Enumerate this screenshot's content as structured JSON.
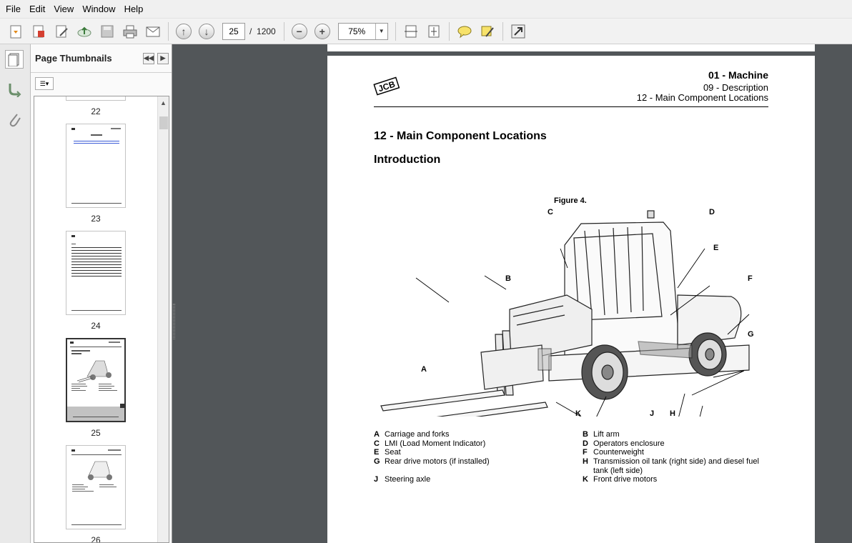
{
  "menu": [
    "File",
    "Edit",
    "View",
    "Window",
    "Help"
  ],
  "toolbar": {
    "page_current": "25",
    "page_sep": "/",
    "page_total": "1200",
    "zoom": "75%"
  },
  "panel": {
    "title": "Page Thumbnails"
  },
  "thumbnails": [
    {
      "label": "22"
    },
    {
      "label": "23"
    },
    {
      "label": "24"
    },
    {
      "label": "25"
    },
    {
      "label": "26"
    }
  ],
  "document": {
    "header_title": "01 - Machine",
    "header_sub1": "09 - Description",
    "header_sub2": "12 - Main Component Locations",
    "logo": "JCB",
    "heading": "12 - Main Component Locations",
    "subheading": "Introduction",
    "figure_caption": "Figure 4.",
    "callouts": {
      "A": "A",
      "B": "B",
      "C": "C",
      "D": "D",
      "E": "E",
      "F": "F",
      "G": "G",
      "H": "H",
      "J": "J",
      "K": "K"
    },
    "legend": [
      {
        "key": "A",
        "text": "Carriage and forks"
      },
      {
        "key": "B",
        "text": "Lift arm"
      },
      {
        "key": "C",
        "text": "LMI (Load Moment Indicator)"
      },
      {
        "key": "D",
        "text": "Operators enclosure"
      },
      {
        "key": "E",
        "text": "Seat"
      },
      {
        "key": "F",
        "text": "Counterweight"
      },
      {
        "key": "G",
        "text": "Rear drive motors (if installed)"
      },
      {
        "key": "H",
        "text": "Transmission oil tank (right side) and diesel fuel"
      },
      {
        "key": "H2",
        "text": "tank (left side)"
      },
      {
        "key": "J",
        "text": "Steering axle"
      },
      {
        "key": "K",
        "text": "Front drive motors"
      }
    ]
  }
}
